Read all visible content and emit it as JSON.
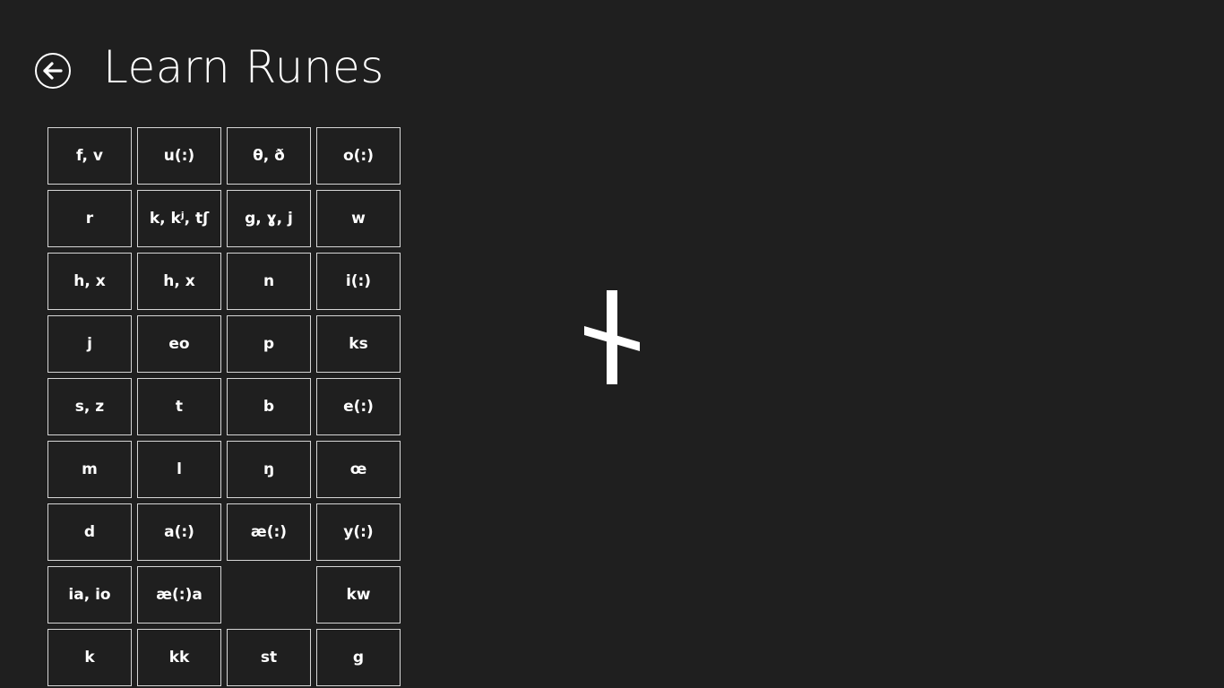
{
  "header": {
    "title": "Learn Runes",
    "back_icon": "back-arrow-icon"
  },
  "rune_buttons": [
    {
      "label": "f, v"
    },
    {
      "label": "u(:)"
    },
    {
      "label": "θ, ð"
    },
    {
      "label": "o(:)"
    },
    {
      "label": "r"
    },
    {
      "label": "k, kʲ, tʃ"
    },
    {
      "label": "g, ɣ, j"
    },
    {
      "label": "w"
    },
    {
      "label": "h, x"
    },
    {
      "label": "h, x"
    },
    {
      "label": "n"
    },
    {
      "label": "i(:)"
    },
    {
      "label": "j"
    },
    {
      "label": "eo"
    },
    {
      "label": "p"
    },
    {
      "label": "ks"
    },
    {
      "label": "s, z"
    },
    {
      "label": "t"
    },
    {
      "label": "b"
    },
    {
      "label": "e(:)"
    },
    {
      "label": "m"
    },
    {
      "label": "l"
    },
    {
      "label": "ŋ"
    },
    {
      "label": "œ"
    },
    {
      "label": "d"
    },
    {
      "label": "a(:)"
    },
    {
      "label": "æ(:)"
    },
    {
      "label": "y(:)"
    },
    {
      "label": "ia, io"
    },
    {
      "label": "æ(:)a"
    },
    {
      "label": ""
    },
    {
      "label": "kw"
    },
    {
      "label": "k"
    },
    {
      "label": "kk"
    },
    {
      "label": "st"
    },
    {
      "label": "g"
    }
  ],
  "display": {
    "rune_icon": "rune-glyph-icon"
  },
  "colors": {
    "background": "#1f1f1f",
    "foreground": "#ffffff",
    "cell_border": "#d6d6d6"
  }
}
